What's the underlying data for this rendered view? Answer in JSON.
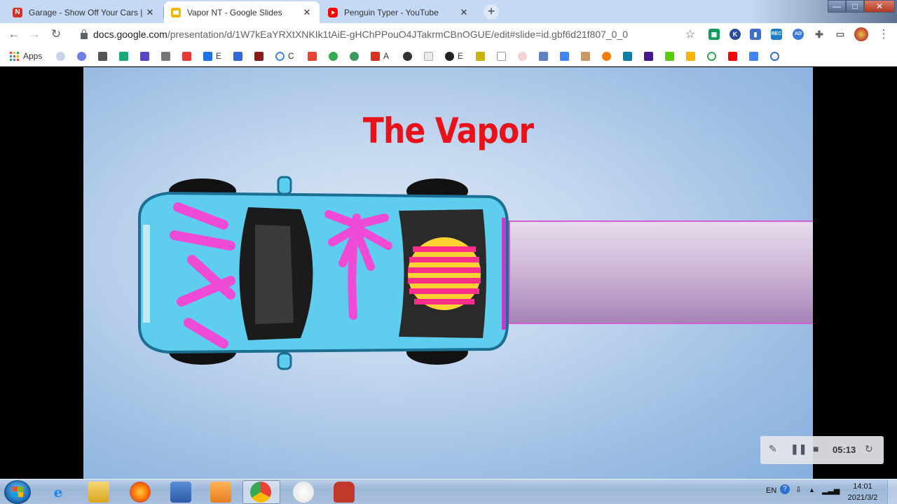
{
  "browser": {
    "tabs": [
      {
        "title": "Garage - Show Off Your Cars |",
        "favicon": "n-icon",
        "active": false
      },
      {
        "title": "Vapor NT - Google Slides",
        "favicon": "slides-icon",
        "active": true
      },
      {
        "title": "Penguin Typer - YouTube",
        "favicon": "youtube-icon",
        "active": false
      }
    ],
    "new_tab_label": "+",
    "url_host": "docs.google.com",
    "url_path": "/presentation/d/1W7kEaYRXtXNKIk1tAiE-gHChPPouO4JTakrmCBnOGUE/edit#slide=id.gbf6d21f807_0_0",
    "window_controls": {
      "minimize": "—",
      "maximize": "□",
      "close": "✕"
    }
  },
  "bookmarks": {
    "apps_label": "Apps",
    "items": [
      {
        "label": "E",
        "color": "#1a73e8"
      },
      {
        "label": "C",
        "color": "#4285f4"
      },
      {
        "label": "A",
        "color": "#ea4335"
      },
      {
        "label": "E",
        "color": "#333333"
      }
    ]
  },
  "slide": {
    "title": "The Vapor",
    "title_color": "#e8131a",
    "trail_color": "#c9a8d2"
  },
  "recorder": {
    "time": "05:13"
  },
  "taskbar": {
    "language": "EN",
    "time": "14:01",
    "date": "2021/3/2"
  }
}
